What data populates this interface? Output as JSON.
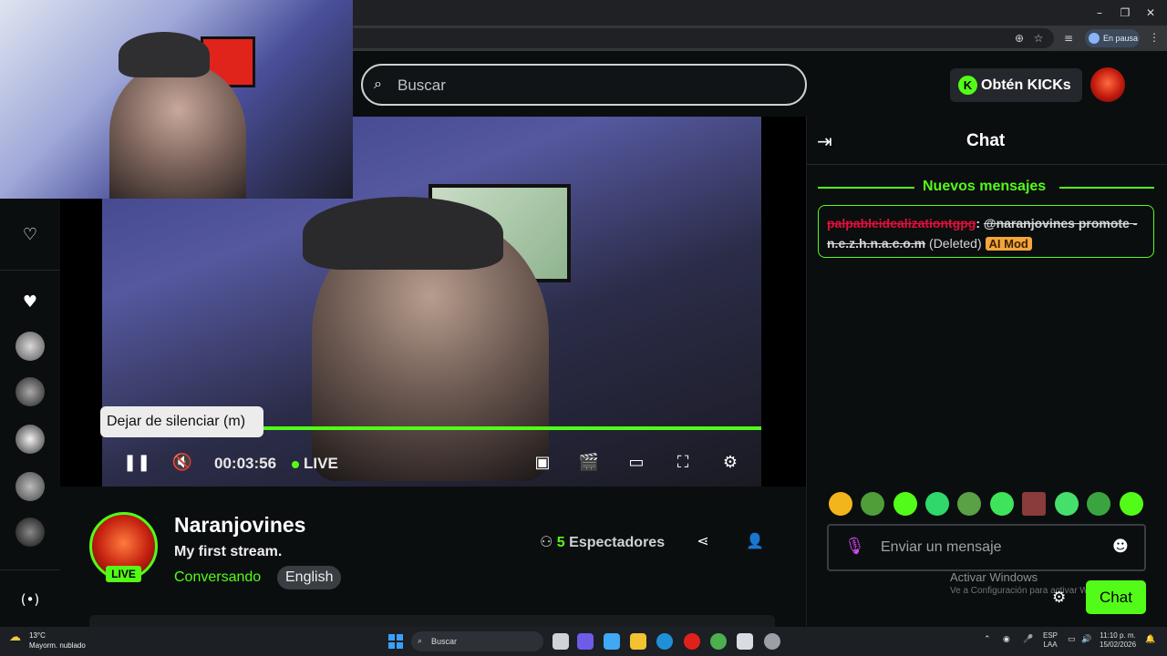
{
  "browser": {
    "paused_label": "En pausa",
    "window_controls": [
      "minimize-icon",
      "restore-icon",
      "close-icon"
    ]
  },
  "topnav": {
    "search_placeholder": "Buscar",
    "kicks_button": "Obtén KICKs",
    "kicks_logo": "K"
  },
  "player": {
    "tooltip": "Dejar de silenciar (m)",
    "elapsed": "00:03:56",
    "live_label": "LIVE"
  },
  "stream": {
    "live_badge": "LIVE",
    "streamer": "Naranjovines",
    "title": "My first stream.",
    "category": "Conversando",
    "language": "English",
    "viewer_count": "5",
    "viewers_label": "Espectadores"
  },
  "chat": {
    "title": "Chat",
    "new_messages": "Nuevos mensajes",
    "message": {
      "username": "palpableidealizationtgpg",
      "separator": ":",
      "body": "@naranjovines promote - n.e.z.h.n.a.c.o.m",
      "deleted": "(Deleted)",
      "badge": "AI Mod"
    },
    "input_placeholder": "Enviar un mensaje",
    "send_button": "Chat",
    "watermark_title": "Activar Windows",
    "watermark_sub": "Ve a Configuración para activar W"
  },
  "taskbar": {
    "temperature": "13°C",
    "weather": "Mayorm. nublado",
    "search": "Buscar",
    "lang_top": "ESP",
    "lang_bottom": "LAA",
    "time": "11:10 p. m.",
    "date": "15/02/2026"
  },
  "colors": {
    "accent": "#53fc18",
    "background": "#0b0e0f",
    "username_red": "#e0103a",
    "ai_mod_badge": "#f2a63b"
  }
}
